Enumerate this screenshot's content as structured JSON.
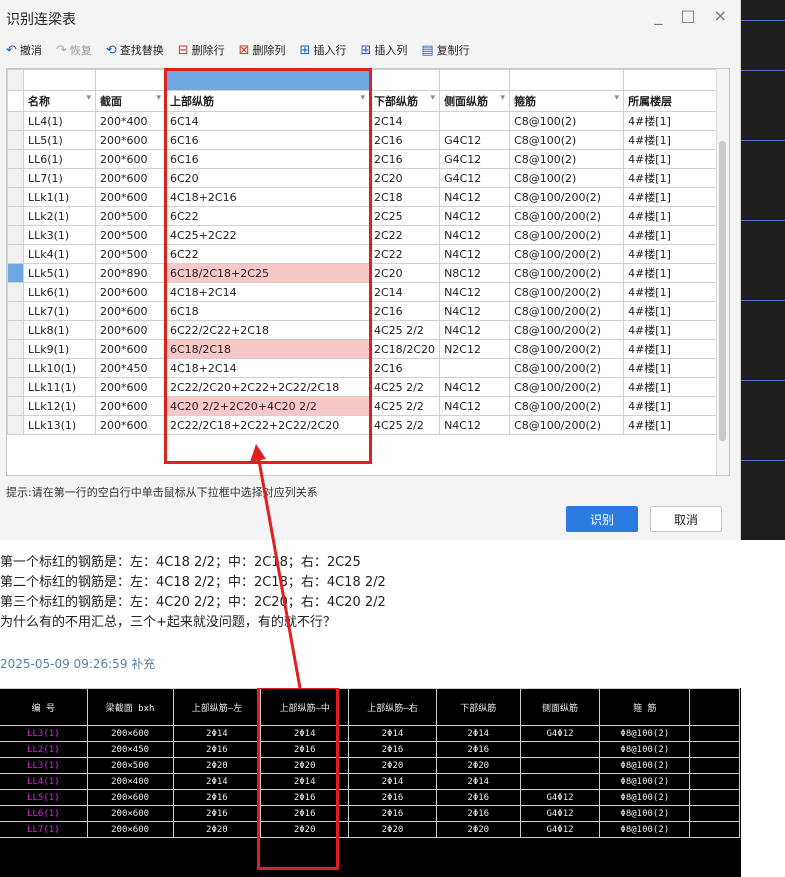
{
  "dialog": {
    "title": "识别连梁表",
    "win_buttons": [
      "_",
      "□",
      "×"
    ],
    "toolbar": [
      {
        "icon": "undo-icon",
        "glyph": "↶",
        "label": "撤消",
        "enabled": true
      },
      {
        "icon": "redo-icon",
        "glyph": "↷",
        "label": "恢复",
        "enabled": false
      },
      {
        "icon": "find-replace-icon",
        "glyph": "⟲",
        "label": "查找替换",
        "enabled": true
      },
      {
        "icon": "delete-row-icon",
        "glyph": "⊟",
        "label": "删除行",
        "enabled": true
      },
      {
        "icon": "delete-column-icon",
        "glyph": "⊠",
        "label": "删除列",
        "enabled": true
      },
      {
        "icon": "insert-row-icon",
        "glyph": "⊞",
        "label": "插入行",
        "enabled": true
      },
      {
        "icon": "insert-column-icon",
        "glyph": "⊞",
        "label": "插入列",
        "enabled": true
      },
      {
        "icon": "copy-row-icon",
        "glyph": "▤",
        "label": "复制行",
        "enabled": true
      }
    ],
    "columns": [
      "名称",
      "截面",
      "上部纵筋",
      "下部纵筋",
      "侧面纵筋",
      "箍筋",
      "所属楼层"
    ],
    "rows": [
      [
        "LL4(1)",
        "200*400",
        "6C14",
        "2C14",
        "",
        "C8@100(2)",
        "4#楼[1]"
      ],
      [
        "LL5(1)",
        "200*600",
        "6C16",
        "2C16",
        "G4C12",
        "C8@100(2)",
        "4#楼[1]"
      ],
      [
        "LL6(1)",
        "200*600",
        "6C16",
        "2C16",
        "G4C12",
        "C8@100(2)",
        "4#楼[1]"
      ],
      [
        "LL7(1)",
        "200*600",
        "6C20",
        "2C20",
        "G4C12",
        "C8@100(2)",
        "4#楼[1]"
      ],
      [
        "LLk1(1)",
        "200*600",
        "4C18+2C16",
        "2C18",
        "N4C12",
        "C8@100/200(2)",
        "4#楼[1]"
      ],
      [
        "LLk2(1)",
        "200*500",
        "6C22",
        "2C25",
        "N4C12",
        "C8@100/200(2)",
        "4#楼[1]"
      ],
      [
        "LLk3(1)",
        "200*500",
        "4C25+2C22",
        "2C22",
        "N4C12",
        "C8@100/200(2)",
        "4#楼[1]"
      ],
      [
        "LLk4(1)",
        "200*500",
        "6C22",
        "2C22",
        "N4C12",
        "C8@100/200(2)",
        "4#楼[1]"
      ],
      [
        "LLk5(1)",
        "200*890",
        "6C18/2C18+2C25",
        "2C20",
        "N8C12",
        "C8@100/200(2)",
        "4#楼[1]"
      ],
      [
        "LLk6(1)",
        "200*600",
        "4C18+2C14",
        "2C14",
        "N4C12",
        "C8@100/200(2)",
        "4#楼[1]"
      ],
      [
        "LLk7(1)",
        "200*600",
        "6C18",
        "2C16",
        "N4C12",
        "C8@100/200(2)",
        "4#楼[1]"
      ],
      [
        "LLk8(1)",
        "200*600",
        "6C22/2C22+2C18",
        "4C25 2/2",
        "N4C12",
        "C8@100/200(2)",
        "4#楼[1]"
      ],
      [
        "LLk9(1)",
        "200*600",
        "6C18/2C18",
        "2C18/2C20",
        "N2C12",
        "C8@100/200(2)",
        "4#楼[1]"
      ],
      [
        "LLk10(1)",
        "200*450",
        "4C18+2C14",
        "2C16",
        "",
        "C8@100/200(2)",
        "4#楼[1]"
      ],
      [
        "LLk11(1)",
        "200*600",
        "2C22/2C20+2C22+2C22/2C18",
        "4C25 2/2",
        "N4C12",
        "C8@100/200(2)",
        "4#楼[1]"
      ],
      [
        "LLk12(1)",
        "200*600",
        "4C20 2/2+2C20+4C20 2/2",
        "4C25 2/2",
        "N4C12",
        "C8@100/200(2)",
        "4#楼[1]"
      ],
      [
        "LLk13(1)",
        "200*600",
        "2C22/2C18+2C22+2C22/2C20",
        "4C25 2/2",
        "N4C12",
        "C8@100/200(2)",
        "4#楼[1]"
      ]
    ],
    "hint": "提示:请在第一行的空白行中单击鼠标从下拉框中选择对应列关系",
    "ok_label": "识别",
    "cancel_label": "取消"
  },
  "post": {
    "lines": [
      "第一个标红的钢筋是：左：4C18 2/2；中：2C18；右：2C25",
      "第二个标红的钢筋是：左：4C18 2/2；中：2C18；右：4C18 2/2",
      "第三个标红的钢筋是：左：4C20 2/2；中：2C20；右：4C20 2/2",
      "为什么有的不用汇总，三个+起来就没问题，有的就不行？"
    ],
    "timestamp": "2025-05-09 09:26:59 补充"
  },
  "cad": {
    "headers": [
      "编 号",
      "梁截面 bxh",
      "上部纵筋—左",
      "上部纵筋—中",
      "上部纵筋—右",
      "下部纵筋",
      "侧面纵筋",
      "箍 筋"
    ],
    "rows": [
      [
        "LL3(1)",
        "200×600",
        "2Φ14",
        "2Φ14",
        "2Φ14",
        "2Φ14",
        "G4Φ12",
        "Φ8@100(2)"
      ],
      [
        "LL2(1)",
        "200×450",
        "2Φ16",
        "2Φ16",
        "2Φ16",
        "2Φ16",
        "",
        "Φ8@100(2)"
      ],
      [
        "LL3(1)",
        "200×500",
        "2Φ20",
        "2Φ20",
        "2Φ20",
        "2Φ20",
        "",
        "Φ8@100(2)"
      ],
      [
        "LL4(1)",
        "200×400",
        "2Φ14",
        "2Φ14",
        "2Φ14",
        "2Φ14",
        "",
        "Φ8@100(2)"
      ],
      [
        "LL5(1)",
        "200×600",
        "2Φ16",
        "2Φ16",
        "2Φ16",
        "2Φ16",
        "G4Φ12",
        "Φ8@100(2)"
      ],
      [
        "LL6(1)",
        "200×600",
        "2Φ16",
        "2Φ16",
        "2Φ16",
        "2Φ16",
        "G4Φ12",
        "Φ8@100(2)"
      ],
      [
        "LL7(1)",
        "200×600",
        "2Φ20",
        "2Φ20",
        "2Φ20",
        "2Φ20",
        "G4Φ12",
        "Φ8@100(2)"
      ]
    ]
  },
  "colors": {
    "highlight": "#e02020",
    "pink_row": "#f8c8c8",
    "accent": "#2b7ce0",
    "cad_label": "#e020e0"
  }
}
